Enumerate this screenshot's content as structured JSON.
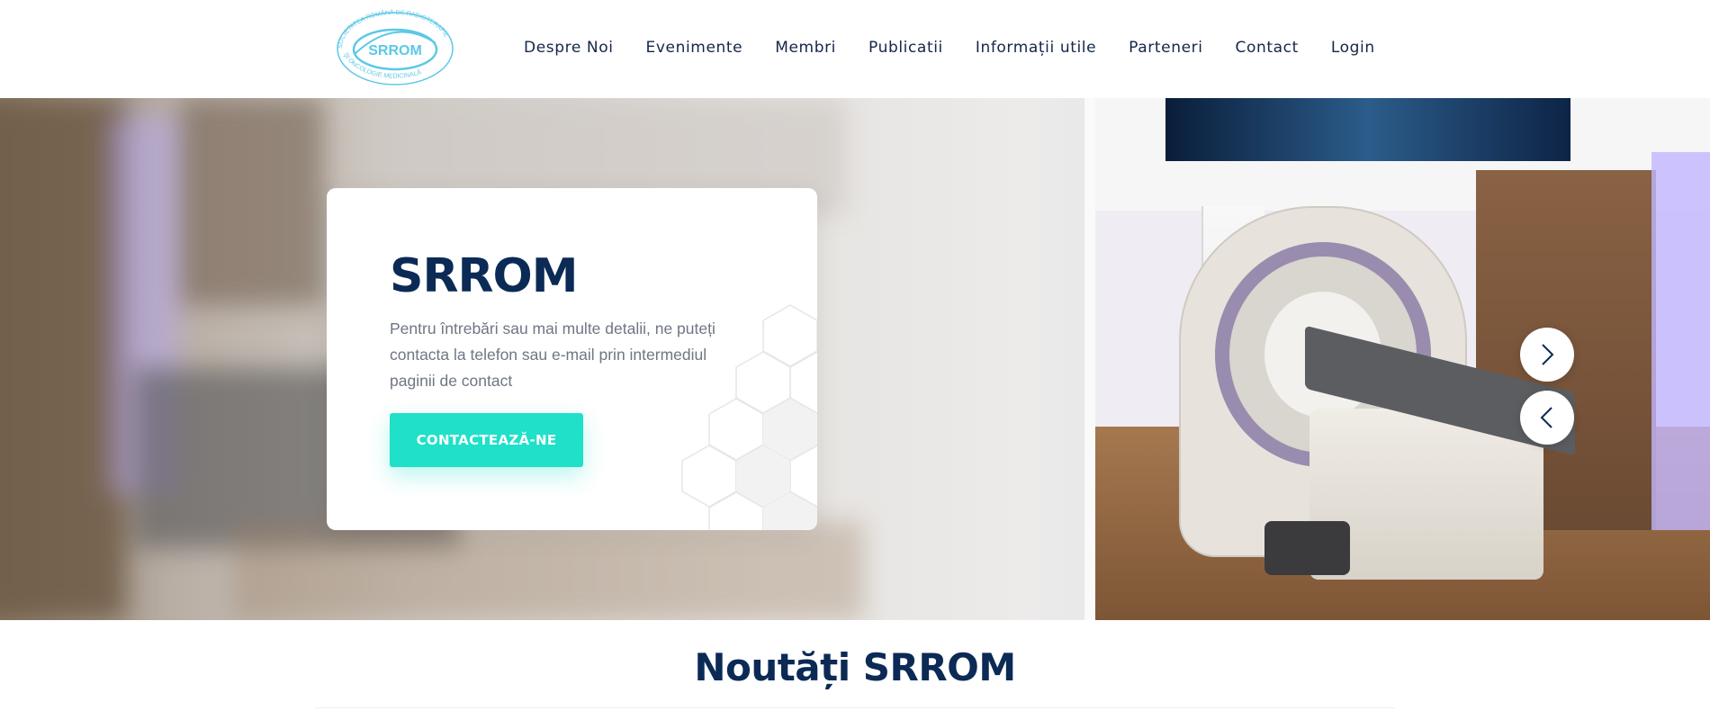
{
  "header": {
    "logo": {
      "name": "srrom-logo-icon",
      "abbreviation": "SRROM",
      "ring_text": "SOCIETATEA ROMÂNĂ DE RADIOTERAPIE ŞI ONCOLOGIE MEDICINALĂ",
      "color": "#5cc8e6"
    },
    "nav": [
      {
        "label": "Despre Noi"
      },
      {
        "label": "Evenimente"
      },
      {
        "label": "Membri"
      },
      {
        "label": "Publicatii"
      },
      {
        "label": "Informații utile"
      },
      {
        "label": "Parteneri"
      },
      {
        "label": "Contact"
      },
      {
        "label": "Login"
      }
    ]
  },
  "hero": {
    "title": "SRROM",
    "text": "Pentru întrebări sau mai multe detalii, ne puteți contacta la telefon sau e-mail prin intermediul paginii de contact",
    "cta_label": "CONTACTEAZĂ-NE",
    "next_icon": "chevron-right-icon",
    "prev_icon": "chevron-left-icon",
    "accent_color": "#1fe0c8",
    "title_color": "#0b2a55"
  },
  "news": {
    "title": "Noutăți SRROM"
  }
}
